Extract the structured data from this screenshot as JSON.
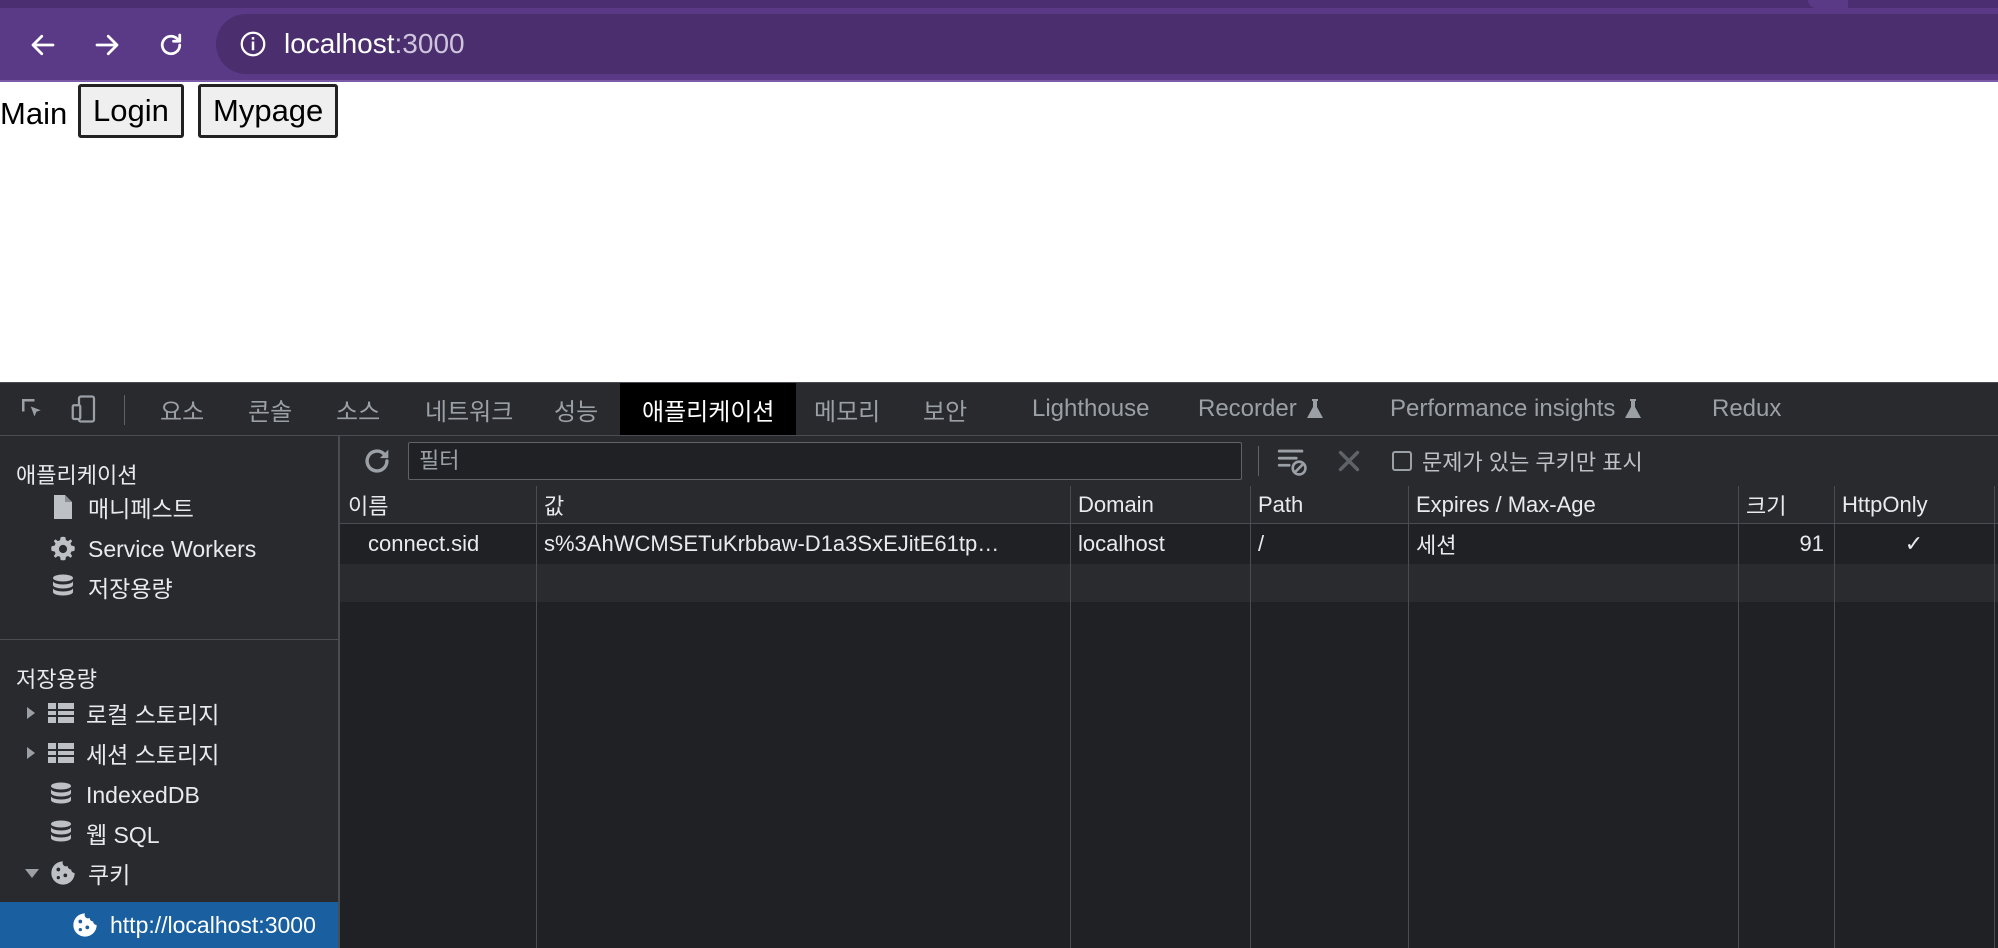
{
  "browser": {
    "url_host": "localhost",
    "url_port": ":3000",
    "back_icon": "arrow-left-icon",
    "forward_icon": "arrow-right-icon",
    "reload_icon": "reload-icon",
    "info_icon": "info-icon"
  },
  "page": {
    "main_label": "Main",
    "buttons": [
      "Login",
      "Mypage"
    ]
  },
  "devtools": {
    "tabs": [
      "요소",
      "콘솔",
      "소스",
      "네트워크",
      "성능",
      "애플리케이션",
      "메모리",
      "보안",
      "Lighthouse",
      "Recorder",
      "Performance insights",
      "Redux"
    ],
    "active_tab": "애플리케이션",
    "sidebar": {
      "section1_title": "애플리케이션",
      "section1_items": [
        "매니페스트",
        "Service Workers",
        "저장용량"
      ],
      "section2_title": "저장용량",
      "section2_items": [
        "로컬 스토리지",
        "세션 스토리지",
        "IndexedDB",
        "웹 SQL",
        "쿠키"
      ],
      "cookie_child": "http://localhost:3000"
    },
    "filterbar": {
      "filter_placeholder": "필터",
      "checkbox_label": "문제가 있는 쿠키만 표시"
    },
    "table": {
      "columns": [
        "이름",
        "값",
        "Domain",
        "Path",
        "Expires / Max-Age",
        "크기",
        "HttpOnly"
      ],
      "rows": [
        {
          "name": "connect.sid",
          "value": "s%3AhWCMSETuKrbbaw-D1a3SxEJitE61tp…",
          "domain": "localhost",
          "path": "/",
          "expires": "세션",
          "size": "91",
          "httponly": "✓"
        }
      ]
    }
  },
  "colors": {
    "toolbar": "#5a3a86",
    "omnibox": "#4a2e6e",
    "devtools_bg": "#202124",
    "selected": "#1a5fa0"
  }
}
